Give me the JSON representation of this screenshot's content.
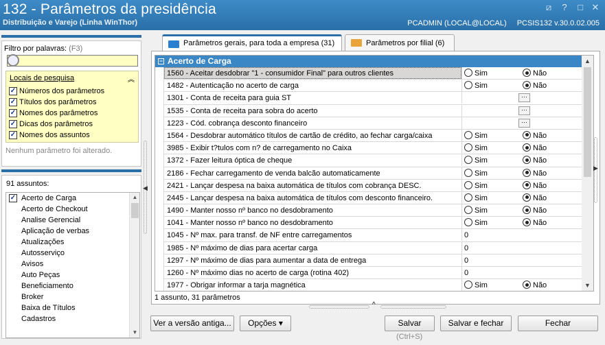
{
  "window": {
    "title": "132 - Parâmetros da presidência",
    "subtitle": "Distribuição e Varejo (Linha WinThor)",
    "user": "PCADMIN (LOCAL@LOCAL)",
    "version": "PCSIS132  v.30.0.02.005"
  },
  "filter": {
    "label": "Filtro por palavras:",
    "hotkey": "(F3)",
    "value": ""
  },
  "search_locations": {
    "title": "Locais de pesquisa",
    "items": [
      {
        "label": "Números dos parâmetros",
        "checked": true
      },
      {
        "label": "Títulos dos parâmetros",
        "checked": true
      },
      {
        "label": "Nomes dos parâmetros",
        "checked": true
      },
      {
        "label": "Dicas dos parâmetros",
        "checked": true
      },
      {
        "label": "Nomes dos assuntos",
        "checked": true
      }
    ]
  },
  "change_status": "Nenhum parâmetro foi alterado.",
  "subjects": {
    "count_label": "91 assuntos:",
    "items": [
      {
        "label": "Acerto de Carga",
        "checked": true
      },
      {
        "label": "Acerto de Checkout"
      },
      {
        "label": "Analise Gerencial"
      },
      {
        "label": "Aplicação de verbas"
      },
      {
        "label": "Atualizações"
      },
      {
        "label": "Autosserviço"
      },
      {
        "label": "Avisos"
      },
      {
        "label": "Auto Peças"
      },
      {
        "label": "Beneficiamento"
      },
      {
        "label": "Broker"
      },
      {
        "label": "Baixa de Títulos"
      },
      {
        "label": "Cadastros"
      }
    ]
  },
  "tabs": [
    {
      "label": "Parâmetros gerais, para toda a empresa",
      "count": "(31)",
      "active": true,
      "icon_color": "#2b7fd0"
    },
    {
      "label": "Parâmetros por filial",
      "count": "(6)",
      "active": false,
      "icon_color": "#e8a33a"
    }
  ],
  "group": {
    "title": "Acerto de Carga",
    "toggle": "−"
  },
  "params": [
    {
      "label": "1560 - Aceitar desdobrar \"1 - consumidor Final\" para outros clientes",
      "type": "radio",
      "value": "Não",
      "selected": true
    },
    {
      "label": "1482 - Autenticação no acerto de carga",
      "type": "radio",
      "value": "Não"
    },
    {
      "label": "1301 - Conta de receita para guia ST",
      "type": "lookup",
      "value": ""
    },
    {
      "label": "1535 - Conta de receita para sobra do acerto",
      "type": "lookup",
      "value": ""
    },
    {
      "label": "1223 - Cód. cobrança desconto financeiro",
      "type": "lookup",
      "value": ""
    },
    {
      "label": "1564 - Desdobrar automático títulos de cartão de crédito, ao fechar carga/caixa",
      "type": "radio",
      "value": "Não"
    },
    {
      "label": "3985 - Exibir t?tulos com n? de carregamento no Caixa",
      "type": "radio",
      "value": "Não"
    },
    {
      "label": "1372 - Fazer leitura óptica de cheque",
      "type": "radio",
      "value": "Não"
    },
    {
      "label": "2186 - Fechar carregamento de venda balcão automaticamente",
      "type": "radio",
      "value": "Não"
    },
    {
      "label": "2421 - Lançar despesa na baixa automática de títulos com cobrança DESC.",
      "type": "radio",
      "value": "Não"
    },
    {
      "label": "2445 - Lançar despesa na baixa automática de títulos com desconto financeiro.",
      "type": "radio",
      "value": "Não"
    },
    {
      "label": "1490 - Manter nosso nº banco no desdobramento",
      "type": "radio",
      "value": "Não"
    },
    {
      "label": "1041 - Manter nosso nº banco no desdobramento",
      "type": "radio",
      "value": "Não"
    },
    {
      "label": "1045 - Nº max. para transf. de NF entre carregamentos",
      "type": "number",
      "value": "0"
    },
    {
      "label": "1985 - Nº máximo de dias para acertar carga",
      "type": "number",
      "value": "0"
    },
    {
      "label": "1297 - Nº máximo de dias para aumentar a data de entrega",
      "type": "number",
      "value": "0"
    },
    {
      "label": "1260 - Nº máximo dias no acerto de carga (rotina 402)",
      "type": "number",
      "value": "0"
    },
    {
      "label": "1977 - Obrigar informar a tarja magnética",
      "type": "radio",
      "value": "Não"
    }
  ],
  "radio_labels": {
    "yes": "Sim",
    "no": "Não"
  },
  "grid_status": "1 assunto, 31 parâmetros",
  "buttons": {
    "old_version": "Ver a versão antiga...",
    "options": "Opções",
    "save": "Salvar",
    "save_hint": "(Ctrl+S)",
    "save_close": "Salvar e fechar",
    "close": "Fechar"
  },
  "colors": {
    "titlebar": "#2a6fa8",
    "accent": "#3b86c4",
    "highlight": "#ffffc4"
  }
}
